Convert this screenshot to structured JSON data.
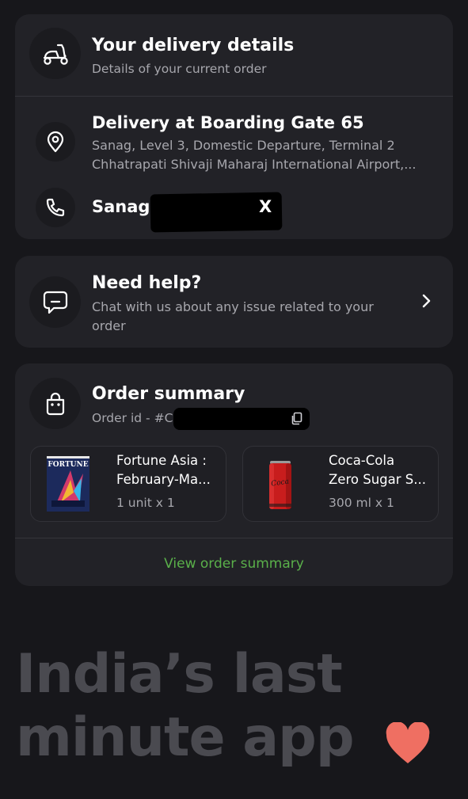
{
  "delivery": {
    "title": "Your delivery details",
    "subtitle": "Details of your current order",
    "address_title": "Delivery at Boarding Gate 65",
    "address_line1": "Sanag, Level 3, Domestic Departure, Terminal 2",
    "address_line2": "Chhatrapati Shivaji Maharaj International Airport,...",
    "contact_name": "Sanag,",
    "contact_suffix": "X",
    "icons": [
      "scooter-icon",
      "location-pin-icon",
      "phone-icon"
    ]
  },
  "help": {
    "title": "Need help?",
    "subtitle_line1": "Chat with us about any issue related to your",
    "subtitle_line2": "order",
    "icons": [
      "chat-icon",
      "chevron-right-icon"
    ]
  },
  "order": {
    "title": "Order summary",
    "order_id_label": "Order id - #",
    "order_id_fragment": "C",
    "items": [
      {
        "name_line1": "Fortune Asia :",
        "name_line2": "February-Ma...",
        "quantity": "1 unit x 1"
      },
      {
        "name_line1": "Coca-Cola",
        "name_line2": "Zero Sugar S...",
        "quantity": "300 ml x 1"
      }
    ],
    "view_link": "View order summary",
    "icons": [
      "bag-icon",
      "copy-icon"
    ]
  },
  "tagline": {
    "line1": "India’s last",
    "line2": "minute app"
  },
  "colors": {
    "background": "#17171b",
    "card": "#222227",
    "link_green": "#5ab04a",
    "heart": "#ef6f62",
    "tagline": "#4a4a50"
  }
}
